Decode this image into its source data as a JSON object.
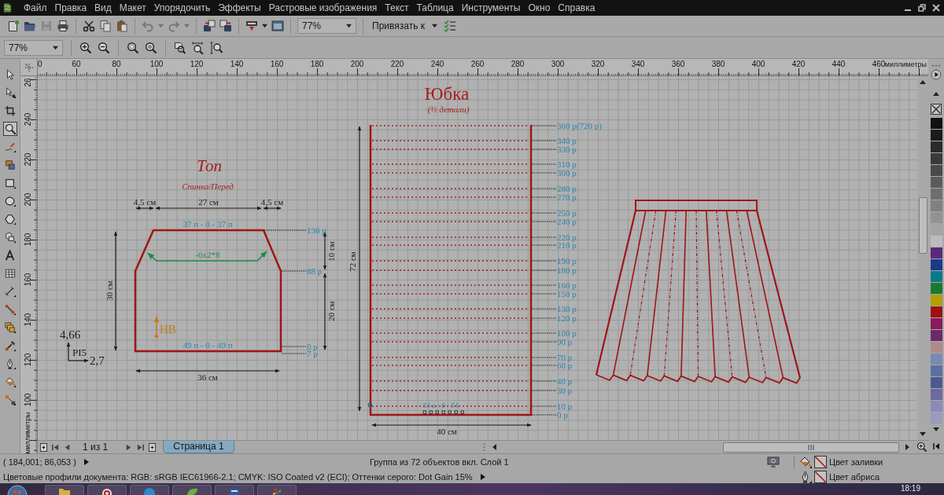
{
  "menu_bar": {
    "items": [
      "Файл",
      "Правка",
      "Вид",
      "Макет",
      "Упорядочить",
      "Эффекты",
      "Растровые изображения",
      "Текст",
      "Таблица",
      "Инструменты",
      "Окно",
      "Справка"
    ]
  },
  "standard_toolbar": {
    "save": {
      "disabled": true
    },
    "undo": {
      "disabled": true
    },
    "redo": {
      "disabled": true
    },
    "zoom_level": "77%",
    "snap_menu": "Привязать к"
  },
  "zoom_toolbar": {
    "zoom_level": "77%"
  },
  "toolbox": {
    "tools": [
      {
        "selected": false
      },
      {
        "selected": false
      },
      {
        "selected": false
      },
      {
        "selected": true
      },
      {
        "selected": false
      },
      {
        "selected": false
      },
      {
        "selected": false
      },
      {
        "selected": false
      },
      {
        "selected": false
      },
      {
        "selected": false
      },
      {
        "selected": false
      },
      {
        "selected": false
      },
      {
        "selected": false
      },
      {
        "selected": false
      },
      {
        "selected": false
      },
      {
        "selected": false
      },
      {
        "selected": false
      },
      {
        "selected": false
      },
      {
        "selected": false
      }
    ]
  },
  "rulers": {
    "horizontal": {
      "labels": [
        "0",
        "60",
        "80",
        "100",
        "120",
        "140",
        "160",
        "180",
        "200",
        "220",
        "240",
        "260",
        "280",
        "300",
        "320",
        "340",
        "360",
        "380",
        "400",
        "420",
        "440",
        "460"
      ],
      "unit": "миллиметры"
    },
    "vertical": {
      "labels": [
        "26",
        "240",
        "220",
        "200",
        "180",
        "160",
        "140",
        "120",
        "100"
      ],
      "unit": "миллиметры"
    }
  },
  "canvas": {
    "top_piece": {
      "title": "Топ",
      "subtitle": "Спинка/Перед",
      "width_labels": [
        "4,5 см",
        "27 см",
        "4,5 см"
      ],
      "top_stitches": "37 п - 0 - 37 п",
      "decrease": "-6x2*8",
      "row_marks": [
        "136 р",
        "88 р",
        "0 р",
        "7 р"
      ],
      "height_labels": [
        "10 см",
        "20 см"
      ],
      "total_height": "30 см",
      "bottom_stitches": "49 п - 0 - 49 п",
      "grain_label": "НВ",
      "bottom_width": "36 см"
    },
    "axis_note": {
      "y_value": "4,66",
      "label": "PI5",
      "x_value": "2,7"
    },
    "skirt_piece": {
      "title": "Юбка",
      "subtitle": "(½ детали)",
      "rows": [
        "360 р(720 р)",
        "340 р",
        "330 р",
        "310 р",
        "300 р",
        "280 р",
        "270 р",
        "250 р",
        "240 р",
        "220 р",
        "210 р",
        "190 р",
        "180 р",
        "160 р",
        "150 р",
        "130 р",
        "120 р",
        "100 р",
        "90 р",
        "70 р",
        "60 р",
        "40 р",
        "30 р",
        "10 р",
        "0 р"
      ],
      "height": "72 см",
      "width": "40 см",
      "bottom_stitches": "54 п - 0 - 54"
    }
  },
  "palette": {
    "swatches": [
      {
        "color": "#111111"
      },
      {
        "color": "#1c1c1c"
      },
      {
        "color": "#2b2b2b"
      },
      {
        "color": "#3a3a3a"
      },
      {
        "color": "#4a4a4a"
      },
      {
        "color": "#5c5c5c"
      },
      {
        "color": "#6e6e6e"
      },
      {
        "color": "#808080"
      },
      {
        "color": "#929292"
      },
      {
        "color": "#a4a4a4"
      },
      {
        "color": "#bcbcbc"
      },
      {
        "color": "#5a2a7a"
      },
      {
        "color": "#1a3a8c"
      },
      {
        "color": "#0a7a8a"
      },
      {
        "color": "#1a7a30"
      },
      {
        "color": "#b0a000"
      },
      {
        "color": "#a01010"
      },
      {
        "color": "#8a1a5a"
      },
      {
        "color": "#6a2a6a"
      },
      {
        "color": "#b08a8a"
      },
      {
        "color": "#7a8ab0"
      },
      {
        "color": "#5a70a0"
      },
      {
        "color": "#4a5a90"
      },
      {
        "color": "#6a6aa0"
      },
      {
        "color": "#8a8ab8"
      },
      {
        "color": "#9a9ac0"
      }
    ]
  },
  "page_bar": {
    "counter": "1 из 1",
    "tabs": [
      {
        "label": "Страница 1",
        "selected": true
      }
    ]
  },
  "status_bar": {
    "coordinates": "( 184,001; 86,053 )",
    "selection_info": "Группа из 72 объектов вкл. Слой 1",
    "color_profiles": "Цветовые профили документа: RGB: sRGB IEC61966-2.1; CMYK: ISO Coated v2 (ECI); Оттенки серого: Dot Gain 15%",
    "fill_label": "Цвет заливки",
    "outline_label": "Цвет абриса"
  },
  "taskbar": {
    "clock": "18:19"
  }
}
